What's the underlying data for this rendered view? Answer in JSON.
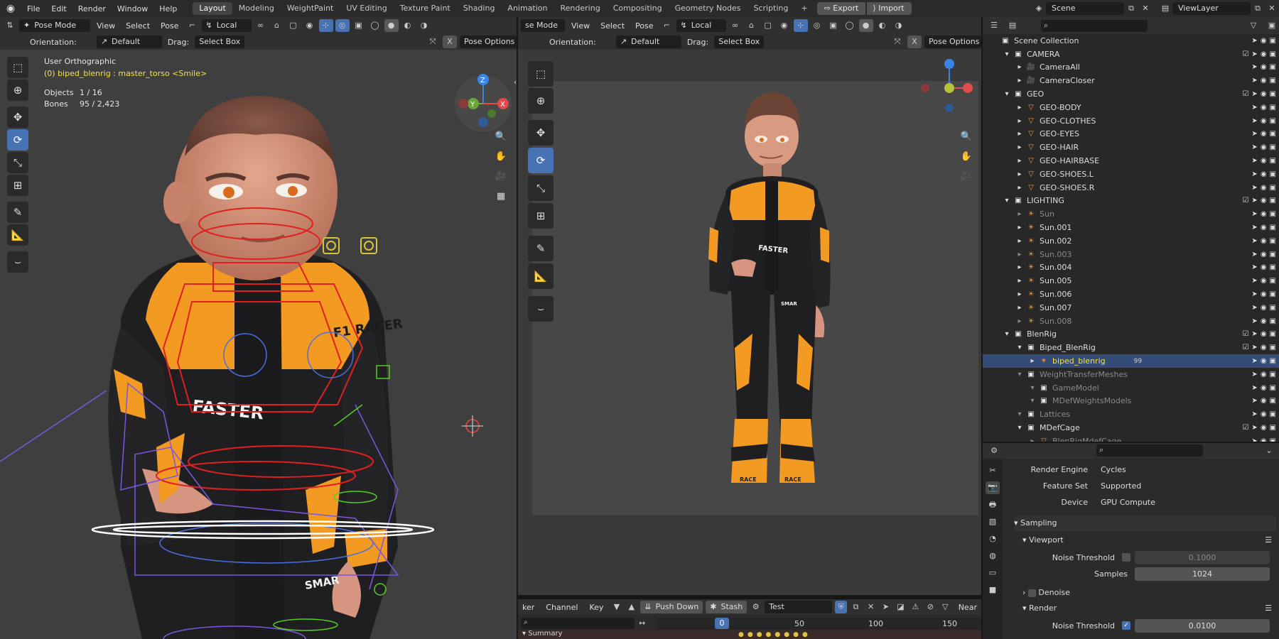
{
  "topbar": {
    "menus": [
      "File",
      "Edit",
      "Render",
      "Window",
      "Help"
    ],
    "workspaces": [
      "Layout",
      "Modeling",
      "WeightPaint",
      "UV Editing",
      "Texture Paint",
      "Shading",
      "Animation",
      "Rendering",
      "Compositing",
      "Geometry Nodes",
      "Scripting"
    ],
    "active_workspace": "Layout",
    "add_workspace": "+",
    "export_label": "Export",
    "import_label": "Import",
    "scene": "Scene",
    "view_layer": "ViewLayer"
  },
  "left_viewport": {
    "mode": "Pose Mode",
    "menus": [
      "View",
      "Select",
      "Pose"
    ],
    "orientation_local": "Local",
    "orientation_label": "Orientation:",
    "orientation_value": "Default",
    "drag_label": "Drag:",
    "drag_value": "Select Box",
    "pose_options": "Pose Options",
    "view_name": "User Orthographic",
    "active_object": "(0) biped_blenrig : master_torso <Smile>",
    "objects_label": "Objects",
    "objects_value": "1 / 16",
    "bones_label": "Bones",
    "bones_value": "95 / 2,423",
    "x_close": "X",
    "gizmo": {
      "z": "Z",
      "y": "Y",
      "x": "X"
    }
  },
  "right_viewport": {
    "mode": "se Mode",
    "menus": [
      "View",
      "Select",
      "Pose"
    ],
    "orientation_local": "Local",
    "orientation_label": "Orientation:",
    "orientation_value": "Default",
    "drag_label": "Drag:",
    "drag_value": "Select Box",
    "pose_options": "Pose Options",
    "x_close": "X"
  },
  "character": {
    "chest_text": "F1 RACER",
    "belly_text": "FASTER",
    "hip_text": "SMAR",
    "boot_text": "RACE"
  },
  "timeline": {
    "menus": [
      "ker",
      "Channel",
      "Key"
    ],
    "push_down": "Push Down",
    "stash": "Stash",
    "action_name": "Test",
    "nearest": "Near",
    "current_frame": "0",
    "ticks": [
      "50",
      "100",
      "150"
    ],
    "summary": "Summary"
  },
  "outliner": {
    "rows": [
      {
        "indent": 0,
        "name": "Scene Collection",
        "icon": "collection",
        "check": false,
        "dim": false
      },
      {
        "indent": 1,
        "name": "CAMERA",
        "icon": "collection",
        "check": true,
        "dim": false
      },
      {
        "indent": 2,
        "name": "CameraAll",
        "icon": "camera",
        "check": false,
        "dim": false
      },
      {
        "indent": 2,
        "name": "CameraCloser",
        "icon": "camera",
        "check": false,
        "dim": false
      },
      {
        "indent": 1,
        "name": "GEO",
        "icon": "collection",
        "check": true,
        "dim": false
      },
      {
        "indent": 2,
        "name": "GEO-BODY",
        "icon": "mesh",
        "check": false,
        "dim": false
      },
      {
        "indent": 2,
        "name": "GEO-CLOTHES",
        "icon": "mesh",
        "check": false,
        "dim": false
      },
      {
        "indent": 2,
        "name": "GEO-EYES",
        "icon": "mesh",
        "check": false,
        "dim": false
      },
      {
        "indent": 2,
        "name": "GEO-HAIR",
        "icon": "mesh",
        "check": false,
        "dim": false
      },
      {
        "indent": 2,
        "name": "GEO-HAIRBASE",
        "icon": "mesh",
        "check": false,
        "dim": false
      },
      {
        "indent": 2,
        "name": "GEO-SHOES.L",
        "icon": "mesh",
        "check": false,
        "dim": false
      },
      {
        "indent": 2,
        "name": "GEO-SHOES.R",
        "icon": "mesh",
        "check": false,
        "dim": false
      },
      {
        "indent": 1,
        "name": "LIGHTING",
        "icon": "collection",
        "check": true,
        "dim": false
      },
      {
        "indent": 2,
        "name": "Sun",
        "icon": "light",
        "check": false,
        "dim": true
      },
      {
        "indent": 2,
        "name": "Sun.001",
        "icon": "light",
        "check": false,
        "dim": false
      },
      {
        "indent": 2,
        "name": "Sun.002",
        "icon": "light",
        "check": false,
        "dim": false
      },
      {
        "indent": 2,
        "name": "Sun.003",
        "icon": "light",
        "check": false,
        "dim": true
      },
      {
        "indent": 2,
        "name": "Sun.004",
        "icon": "light",
        "check": false,
        "dim": false
      },
      {
        "indent": 2,
        "name": "Sun.005",
        "icon": "light",
        "check": false,
        "dim": false
      },
      {
        "indent": 2,
        "name": "Sun.006",
        "icon": "light",
        "check": false,
        "dim": false
      },
      {
        "indent": 2,
        "name": "Sun.007",
        "icon": "light",
        "check": false,
        "dim": false
      },
      {
        "indent": 2,
        "name": "Sun.008",
        "icon": "light",
        "check": false,
        "dim": true
      },
      {
        "indent": 1,
        "name": "BlenRig",
        "icon": "collection",
        "check": true,
        "dim": false
      },
      {
        "indent": 2,
        "name": "Biped_BlenRig",
        "icon": "collection",
        "check": true,
        "dim": false
      },
      {
        "indent": 3,
        "name": "biped_blenrig",
        "icon": "armature",
        "check": false,
        "dim": false,
        "selected": true,
        "badge": "99"
      },
      {
        "indent": 2,
        "name": "WeightTransferMeshes",
        "icon": "collection",
        "check": false,
        "dim": true
      },
      {
        "indent": 3,
        "name": "GameModel",
        "icon": "collection",
        "check": false,
        "dim": true
      },
      {
        "indent": 3,
        "name": "MDefWeightsModels",
        "icon": "collection",
        "check": false,
        "dim": true
      },
      {
        "indent": 2,
        "name": "Lattices",
        "icon": "collection",
        "check": false,
        "dim": true
      },
      {
        "indent": 2,
        "name": "MDefCage",
        "icon": "collection",
        "check": true,
        "dim": false
      },
      {
        "indent": 3,
        "name": "BlenRigMdefCage",
        "icon": "mesh",
        "check": false,
        "dim": true
      }
    ]
  },
  "properties": {
    "render_engine_label": "Render Engine",
    "render_engine": "Cycles",
    "feature_set_label": "Feature Set",
    "feature_set": "Supported",
    "device_label": "Device",
    "device": "GPU Compute",
    "sampling": "Sampling",
    "viewport": "Viewport",
    "noise_threshold_label": "Noise Threshold",
    "viewport_noise": "0.1000",
    "samples_label": "Samples",
    "samples": "1024",
    "denoise": "Denoise",
    "render": "Render",
    "render_noise": "0.0100"
  },
  "colors": {
    "accent": "#4772b3",
    "selected_row": "#334c78",
    "suit_orange": "#f39a22",
    "suit_black": "#1f1f22",
    "bone_red": "#e0201f",
    "bone_purple": "#7b57e0",
    "bone_green": "#55cc22"
  }
}
